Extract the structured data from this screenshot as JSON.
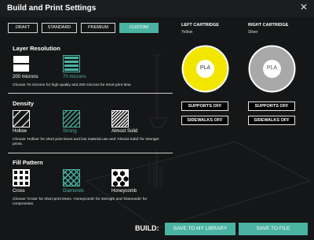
{
  "dialog": {
    "title": "Build and Print Settings"
  },
  "tabs": [
    {
      "label": "DRAFT",
      "active": false
    },
    {
      "label": "STANDARD",
      "active": false
    },
    {
      "label": "PREMIUM",
      "active": false
    },
    {
      "label": "CUSTOM",
      "active": true
    }
  ],
  "layer_resolution": {
    "title": "Layer Resolution",
    "options": [
      {
        "label": "200 microns",
        "selected": false
      },
      {
        "label": "70 microns",
        "selected": true
      }
    ],
    "help": "Choose 70 microns for high quality and 200 microns for short print time"
  },
  "density": {
    "title": "Density",
    "options": [
      {
        "label": "Hollow",
        "selected": false
      },
      {
        "label": "Strong",
        "selected": true
      },
      {
        "label": "Almost Solid",
        "selected": false
      }
    ],
    "help": "Choose 'Hollow' for short print times and low material use and 'Almost Solid' for stronger prints."
  },
  "fill_pattern": {
    "title": "Fill Pattern",
    "options": [
      {
        "label": "Cross",
        "selected": false
      },
      {
        "label": "Diamonds",
        "selected": true
      },
      {
        "label": "Honeycomb",
        "selected": false
      }
    ],
    "help": "Choose 'Cross' for short print times, 'Honeycomb' for strength and 'Diamonds' for compromise."
  },
  "left_cartridge": {
    "title": "LEFT CARTRIDGE",
    "color_name": "Yellow",
    "color": "#f2e600",
    "material": "PLA",
    "supports": "SUPPORTS OFF",
    "sidewalks": "SIDEWALKS OFF"
  },
  "right_cartridge": {
    "title": "RIGHT CARTRIDGE",
    "color_name": "Silver",
    "color": "#a8a8a8",
    "material": "PLA",
    "supports": "SUPPORTS OFF",
    "sidewalks": "SIDEWALKS OFF"
  },
  "build": {
    "label": "BUILD:",
    "save_library": "SAVE TO MY LIBRARY",
    "save_file": "SAVE TO FILE"
  },
  "colors": {
    "accent": "#4ab3a2",
    "background": "#151617"
  }
}
